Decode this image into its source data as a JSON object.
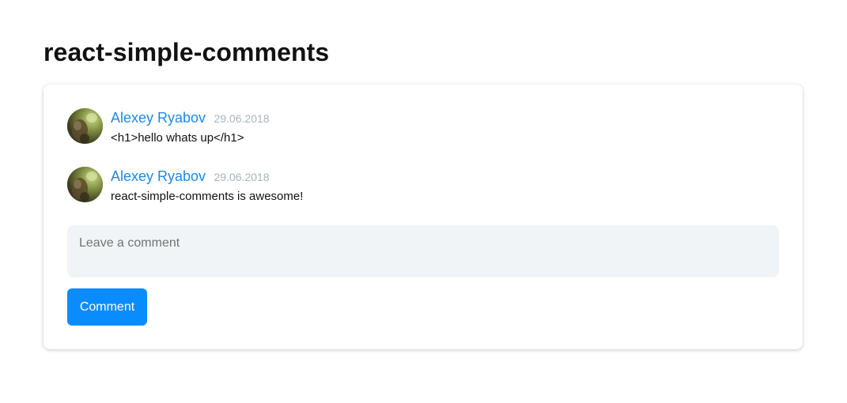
{
  "page": {
    "title": "react-simple-comments"
  },
  "comments": [
    {
      "author": "Alexey Ryabov",
      "date": "29.06.2018",
      "text": "<h1>hello whats up</h1>",
      "avatar_icon": "user-photo-avatar"
    },
    {
      "author": "Alexey Ryabov",
      "date": "29.06.2018",
      "text": "react-simple-comments is awesome!",
      "avatar_icon": "user-photo-avatar"
    }
  ],
  "form": {
    "placeholder": "Leave a comment",
    "value": "",
    "submit_label": "Comment"
  },
  "colors": {
    "author_link": "#1e88e5",
    "date_text": "#a9b4be",
    "input_background": "#f1f4f7",
    "button_background": "#0a8cff",
    "button_text": "#ffffff"
  }
}
